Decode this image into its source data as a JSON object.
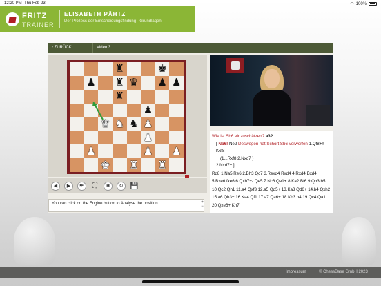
{
  "status_bar": {
    "time": "12:20 PM",
    "date": "Thu Feb 23",
    "battery": "100%"
  },
  "header": {
    "brand_title": "FRITZ",
    "brand_sub": "TRAINER",
    "author": "ELISABETH PÄHTZ",
    "course": "Der Prozess der Entscheidungsfindung - Grundlagen",
    "accent_color": "#8bb636"
  },
  "nav": {
    "back_label": "ZURÜCK",
    "video_label": "Video 3"
  },
  "board": {
    "squares": [
      [
        "",
        "",
        "",
        "r",
        "",
        "",
        "k",
        ""
      ],
      [
        "",
        "p",
        "",
        "r",
        "q",
        "",
        "p",
        "p"
      ],
      [
        "",
        "",
        "",
        "r",
        "",
        "",
        "",
        ""
      ],
      [
        "",
        "",
        "",
        "",
        "",
        "p",
        "",
        ""
      ],
      [
        "",
        "",
        "Q",
        "N",
        "n",
        "P",
        "",
        ""
      ],
      [
        "",
        "",
        "",
        "",
        "",
        "P",
        "",
        ""
      ],
      [
        "",
        "P",
        "",
        "",
        "",
        "P",
        "",
        "P"
      ],
      [
        "",
        "",
        "K",
        "",
        "R",
        "",
        "R",
        ""
      ]
    ]
  },
  "toolbar": {
    "buttons": [
      "back-button",
      "forward-button",
      "end-button",
      "fullscreen-button",
      "engine-button",
      "flip-board-button",
      "save-button"
    ]
  },
  "engine": {
    "hint": "You can click on the Engine button to Analyse the position"
  },
  "notation": {
    "question": "Wie ist Sb6 einzuschätzen?",
    "question_move": "a3?",
    "line1_bracket": "[",
    "line1_move": "Nb6!",
    "line1_rest": "Ne2",
    "line1_comment": "Deswegen hat Schort Sb6 verworfen",
    "line1_tail": "1.Qf8+!!",
    "line2": "Kxf8",
    "line3": "(1...Rxf8 2.Nxd7 )",
    "line4": "2.Nxd7+ ]",
    "main_moves": "Rd8 1.Na5 Re6 2.Bh3 Qc7 3.Rexd4 Rxd4 4.Rxd4 Bxd4 5.Bxe6 fxe6 6.Qxb7+- Qe5 7.Nc6 Qe1+ 8.Ka2 Bf6 9.Qb3 h5 10.Qc2 Qh1 11.a4 Qxf3 12.a5 Qd5+ 13.Ka3 Qd6+ 14.b4 Qxh2 15.a6 Qh3+ 16.Ka4 Qf1 17.a7 Qa6+ 18.Kb3 h4 19.Qc4 Qa1 20.Qxe6+ Kh7"
  },
  "footer": {
    "imprint": "Impressum",
    "copyright": "© ChessBase GmbH 2023"
  }
}
